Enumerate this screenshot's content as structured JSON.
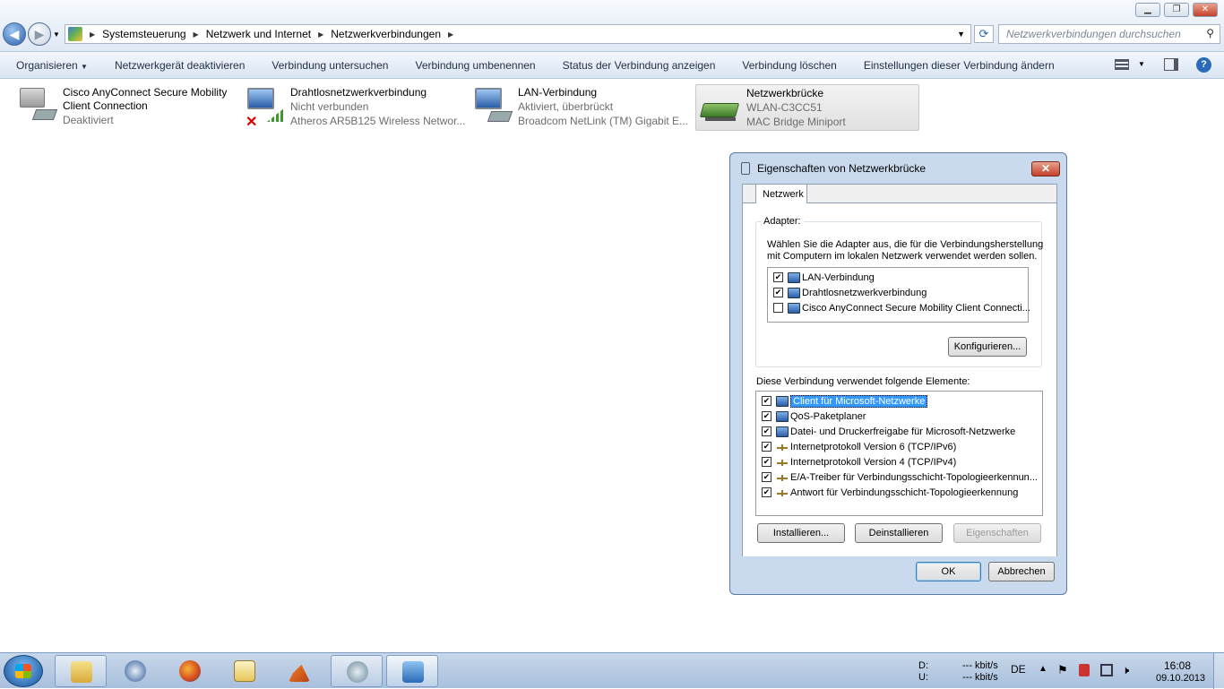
{
  "window": {
    "minimize": "▁",
    "maximize": "❐",
    "close": "✕"
  },
  "nav": {
    "breadcrumb": [
      "Systemsteuerung",
      "Netzwerk und Internet",
      "Netzwerkverbindungen"
    ],
    "search_placeholder": "Netzwerkverbindungen durchsuchen"
  },
  "commands": {
    "organize": "Organisieren",
    "items": [
      "Netzwerkgerät deaktivieren",
      "Verbindung untersuchen",
      "Verbindung umbenennen",
      "Status der Verbindung anzeigen",
      "Verbindung löschen",
      "Einstellungen dieser Verbindung ändern"
    ]
  },
  "connections": [
    {
      "name": "Cisco AnyConnect Secure Mobility",
      "name2": "Client Connection",
      "status": "Deaktiviert",
      "device": ""
    },
    {
      "name": "Drahtlosnetzwerkverbindung",
      "status": "Nicht verbunden",
      "device": "Atheros AR5B125 Wireless Networ..."
    },
    {
      "name": "LAN-Verbindung",
      "status": "Aktiviert, überbrückt",
      "device": "Broadcom NetLink (TM) Gigabit E..."
    },
    {
      "name": "Netzwerkbrücke",
      "status": "WLAN-C3CC51",
      "device": "MAC Bridge Miniport"
    }
  ],
  "dialog": {
    "title": "Eigenschaften von Netzwerkbrücke",
    "tab": "Netzwerk",
    "adapter_group": "Adapter:",
    "adapter_desc1": "Wählen Sie die Adapter aus, die für die Verbindungsherstellung",
    "adapter_desc2": "mit Computern im lokalen Netzwerk verwendet werden sollen.",
    "adapters": [
      {
        "label": "LAN-Verbindung",
        "checked": "✔"
      },
      {
        "label": "Drahtlosnetzwerkverbindung",
        "checked": "✔"
      },
      {
        "label": "Cisco AnyConnect Secure Mobility Client Connecti...",
        "checked": ""
      }
    ],
    "configure": "Konfigurieren...",
    "elements_label": "Diese Verbindung verwendet folgende Elemente:",
    "elements": [
      {
        "label": "Client für Microsoft-Netzwerke",
        "checked": "✔"
      },
      {
        "label": "QoS-Paketplaner",
        "checked": "✔"
      },
      {
        "label": "Datei- und Druckerfreigabe für Microsoft-Netzwerke",
        "checked": "✔"
      },
      {
        "label": "Internetprotokoll Version 6 (TCP/IPv6)",
        "checked": "✔"
      },
      {
        "label": "Internetprotokoll Version 4 (TCP/IPv4)",
        "checked": "✔"
      },
      {
        "label": "E/A-Treiber für Verbindungsschicht-Topologieerkennun...",
        "checked": "✔"
      },
      {
        "label": "Antwort für Verbindungsschicht-Topologieerkennung",
        "checked": "✔"
      }
    ],
    "install": "Installieren...",
    "uninstall": "Deinstallieren",
    "properties": "Eigenschaften",
    "ok": "OK",
    "cancel": "Abbrechen"
  },
  "tray": {
    "d_label": "D:",
    "u_label": "U:",
    "d_rate": "--- kbit/s",
    "u_rate": "--- kbit/s",
    "lang": "DE",
    "time": "16:08",
    "date": "09.10.2013"
  },
  "colors": {
    "selection": "#3399ff",
    "window_frame": "#c9daee",
    "close_button": "#c3412a"
  }
}
